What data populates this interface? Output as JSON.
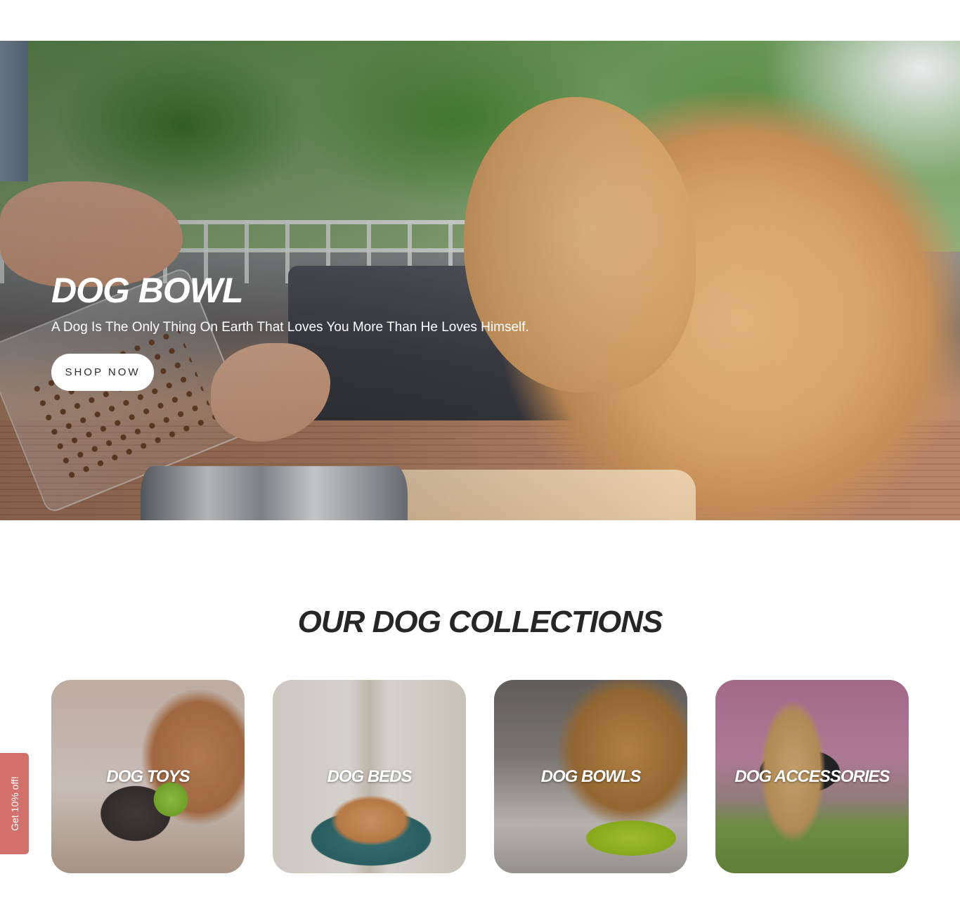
{
  "hero": {
    "title": "DOG BOWL",
    "subtitle": "A Dog Is The Only Thing On Earth That Loves You More Than He Loves Himself.",
    "button_label": "SHOP NOW"
  },
  "collections": {
    "title": "OUR DOG COLLECTIONS",
    "items": [
      {
        "label": "DOG TOYS"
      },
      {
        "label": "DOG BEDS"
      },
      {
        "label": "DOG BOWLS"
      },
      {
        "label": "DOG ACCESSORIES"
      }
    ]
  },
  "discount_tab": {
    "label": "Get 10% off!",
    "color": "#d2716b"
  }
}
